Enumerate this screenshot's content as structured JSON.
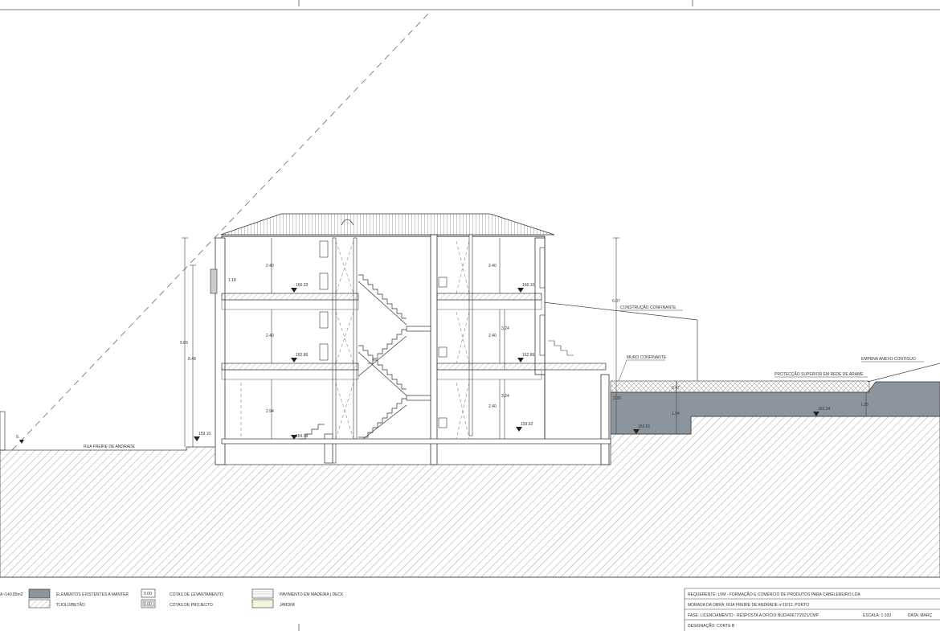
{
  "labels": {
    "rua": "RUA FREIRE DE ANDRADE",
    "construcao": "CONSTRUÇÃO CONFINANTE",
    "muro": "MURO CONFINANTE",
    "empena": "EMPENA ANEXO CONTÍGUO",
    "proteccao": "PROTECÇÃO SUPERIOR EM REDE DE ARAME"
  },
  "levels": {
    "l1": "166.33",
    "l2": "166.10",
    "l3": "162.86",
    "l4": "162.86",
    "l5": "159.08",
    "l6": "159.62",
    "l7": "159.10",
    "l8": "159.51",
    "l9": "162.34"
  },
  "dims": {
    "d1": "2.40",
    "d2": "2.40",
    "d3": "2.40",
    "d4": "2.40",
    "d5": "2.94",
    "d6": "2.40",
    "d7": "3.24",
    "d8": "3.24",
    "d9": "1.18",
    "d10": "9.89",
    "d11": "8.48",
    "d12": "6.07",
    "d13": "3.30",
    "d14": "1.94",
    "d15": "0.47",
    "d16": "1.23",
    "d17": "9.",
    "d18": "A~140.85m2"
  },
  "legend": {
    "existentes": "ELEMENTOS EXISTENTES A MANTER",
    "tijolo": "TIJOLO/BETÃO",
    "cota_lev_box": "0.00",
    "cota_lev": "COTAS DE LEVANTAMENTO",
    "cota_proj_box": "0.00",
    "cota_proj": "COTAS DE PROJECTO",
    "pavimento": "PAVIMENTO EM MADEIRA | DECK",
    "jardim": "JARDIM"
  },
  "titleblock": {
    "requerente": "REQUERENTE: LVM - FORMAÇÃO E COMÉRCIO DE PRODUTOS PARA CABELEREIRO LDA",
    "morada": "MORADA DA OBRA: RUA FREIRE DE ANDRADE nº10/12, PORTO",
    "fase": "FASE: LICENCIAMENTO - RESPOSTA A OFÍCIO NUD/40677/2021/CMP",
    "escala": "ESCALA: 1:100",
    "data": "DATA: MARÇ",
    "designacao": "DESIGNAÇÃO: CORTE B"
  },
  "colors": {
    "existing_fill": "#8c949c",
    "line": "#333333",
    "garden_fill": "#f4f4dc"
  }
}
